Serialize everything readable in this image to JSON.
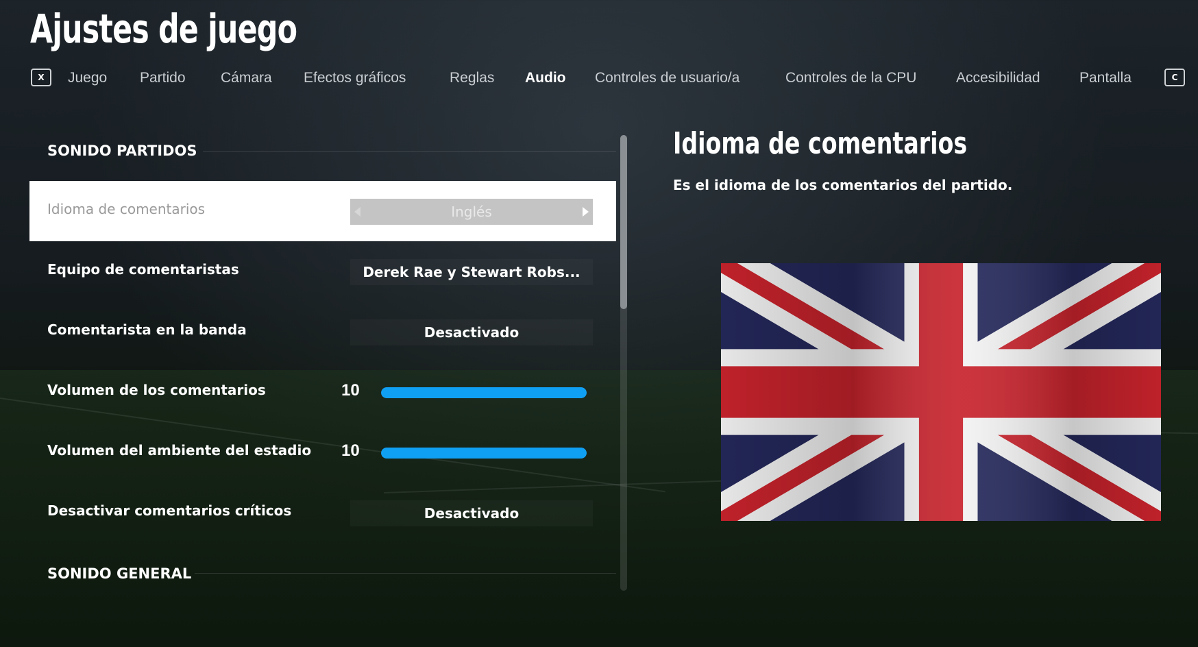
{
  "page": {
    "title": "Ajustes de juego"
  },
  "tabs": {
    "prev_key": "X",
    "next_key": "C",
    "items": [
      {
        "label": "Juego"
      },
      {
        "label": "Partido"
      },
      {
        "label": "Cámara"
      },
      {
        "label": "Efectos gráficos"
      },
      {
        "label": "Reglas"
      },
      {
        "label": "Audio"
      },
      {
        "label": "Controles de usuario/a"
      },
      {
        "label": "Controles de la CPU"
      },
      {
        "label": "Accesibilidad"
      },
      {
        "label": "Pantalla"
      }
    ],
    "active": "Audio"
  },
  "settings": {
    "section_match": "SONIDO PARTIDOS",
    "section_general": "SONIDO GENERAL",
    "rows": [
      {
        "label": "Idioma de comentarios",
        "value": "Inglés",
        "type": "selector",
        "selected": true
      },
      {
        "label": "Equipo de comentaristas",
        "value": "Derek Rae y Stewart Robs...",
        "type": "value"
      },
      {
        "label": "Comentarista en la banda",
        "value": "Desactivado",
        "type": "value"
      },
      {
        "label": "Volumen de los comentarios",
        "value": "10",
        "level": 1.0,
        "type": "slider"
      },
      {
        "label": "Volumen del ambiente del estadio",
        "value": "10",
        "level": 1.0,
        "type": "slider"
      },
      {
        "label": "Desactivar comentarios críticos",
        "value": "Desactivado",
        "type": "value"
      }
    ]
  },
  "detail": {
    "title": "Idioma de comentarios",
    "description": "Es el idioma de los comentarios del partido.",
    "image": "union-jack-flag"
  },
  "colors": {
    "accent": "#10a0f3",
    "selected_row_bg": "#ffffff",
    "flag_red": "#c8232c",
    "flag_blue": "#24285a",
    "flag_white": "#f2f2f2"
  }
}
